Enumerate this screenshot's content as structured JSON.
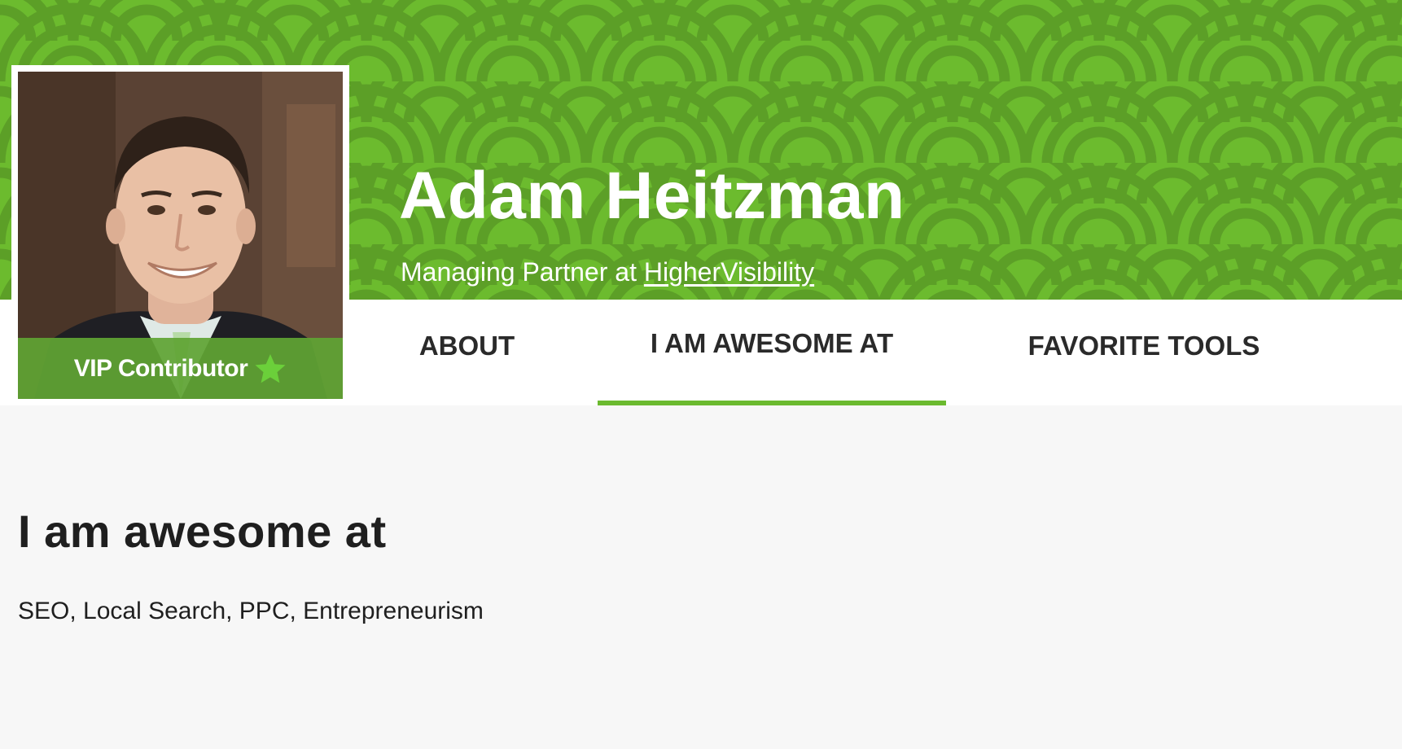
{
  "profile": {
    "name": "Adam Heitzman",
    "role_prefix": "Managing Partner at ",
    "company_link": "HigherVisibility",
    "badge_label": "VIP Contributor",
    "badge_icon": "star-icon"
  },
  "tabs": [
    {
      "label": "ABOUT",
      "active": false
    },
    {
      "label": "I AM AWESOME AT",
      "active": true
    },
    {
      "label": "FAVORITE TOOLS",
      "active": false
    }
  ],
  "section": {
    "title": "I am awesome at",
    "body": "SEO, Local Search, PPC, Entrepreneurism"
  },
  "colors": {
    "banner_green": "#6bba2f",
    "banner_green_dark": "#5da028",
    "active_tab_underline": "#6bba2f",
    "badge_band": "#60a434",
    "page_background": "#f7f7f7"
  }
}
